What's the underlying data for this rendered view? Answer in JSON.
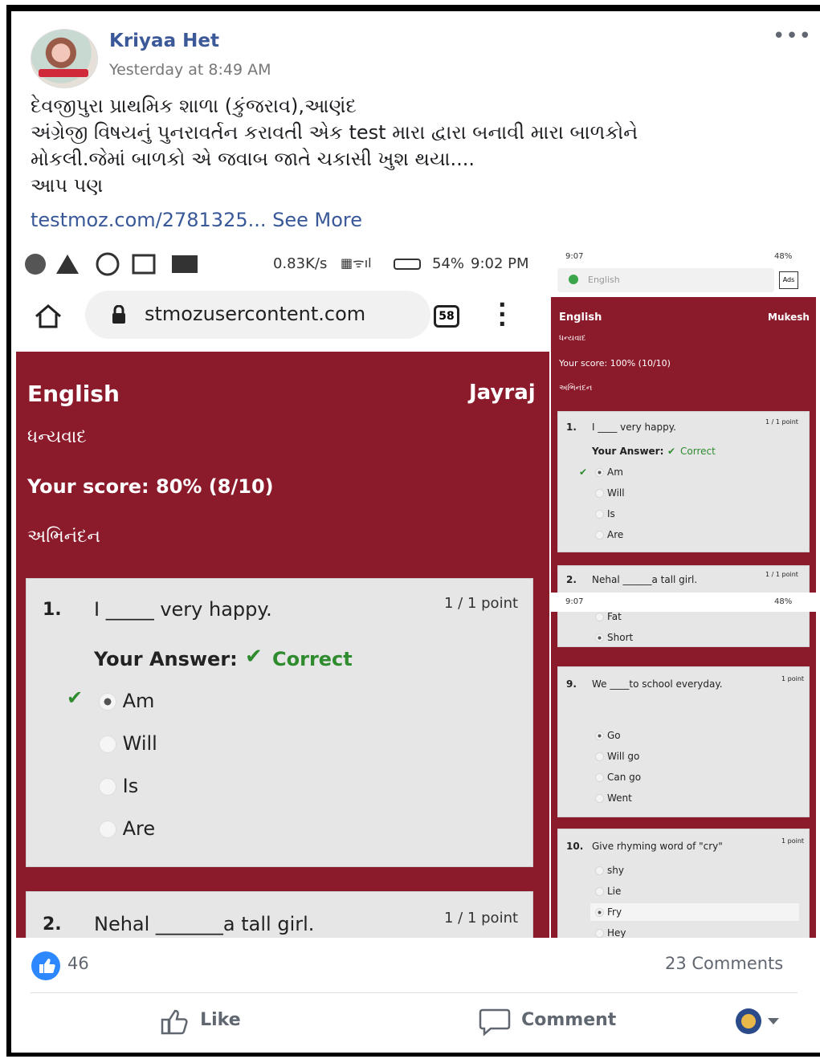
{
  "post": {
    "author": "Kriyaa Het",
    "timestamp": "Yesterday at 8:49 AM",
    "text_line1": "દેવજીપુરા પ્રાથમિક શાળા (કુંજરાવ),આણંદ",
    "text_line2": "અંગ્રેજી વિષયનું પુનરાવર્તન કરાવતી એક test મારા દ્વારા બનાવી મારા બાળકોને",
    "text_line3": "મોકલી.જેમાં બાળકો એ જવાબ જાતે ચકાસી ખુશ થયા....",
    "text_line4": "આપ પણ",
    "link_text": "testmoz.com/2781325...",
    "see_more": "See More",
    "like_count": "46",
    "comment_count": "23 Comments",
    "actions": {
      "like": "Like",
      "comment": "Comment"
    }
  },
  "left_screenshot": {
    "status": {
      "speed": "0.83K/s",
      "battery": "54%",
      "time": "9:02 PM"
    },
    "url": "stmozusercontent.com",
    "tab_count": "58",
    "quiz": {
      "subject": "English",
      "student": "Jayraj",
      "thanks": "ધન્યવાદ",
      "score": "Your score: 80% (8/10)",
      "congrats": "અભિનંદન",
      "q1": {
        "number": "1.",
        "text": "I _____ very happy.",
        "points": "1 / 1 point",
        "answer_label": "Your Answer:",
        "answer_status": "Correct",
        "options": [
          "Am",
          "Will",
          "Is",
          "Are"
        ]
      },
      "q2": {
        "number": "2.",
        "text": "Nehal _______a tall girl.",
        "points": "1 / 1 point"
      }
    }
  },
  "right_screenshot": {
    "status_time": "9:07",
    "status_battery": "48%",
    "search_text": "English",
    "subject": "English",
    "student": "Mukesh",
    "thanks": "ધન્યવાદ",
    "score": "Your score: 100% (10/10)",
    "congrats": "અભિનંદન",
    "q1": {
      "number": "1.",
      "text": "I ____ very happy.",
      "points": "1 / 1 point",
      "answer_label": "Your Answer:",
      "answer_status": "Correct",
      "options": [
        "Am",
        "Will",
        "Is",
        "Are"
      ]
    },
    "q2": {
      "number": "2.",
      "text": "Nehal ______a tall girl.",
      "points": "1 / 1 point",
      "options": [
        "Fat",
        "Short"
      ]
    },
    "q9": {
      "number": "9.",
      "text": "We ____to school everyday.",
      "points": "1 point",
      "options": [
        "Go",
        "Will go",
        "Can go",
        "Went"
      ]
    },
    "q10": {
      "number": "10.",
      "text": "Give rhyming word of \"cry\"",
      "points": "1 point",
      "options": [
        "shy",
        "Lie",
        "Fry",
        "Hey"
      ]
    }
  },
  "colors": {
    "quiz_bg": "#8b1a2b",
    "fb_blue": "#3b5998",
    "correct_green": "#2e8b2e"
  }
}
